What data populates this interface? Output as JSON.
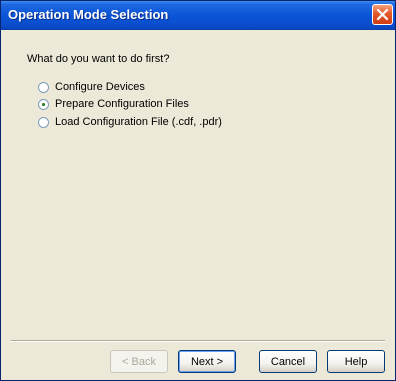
{
  "window": {
    "title": "Operation Mode Selection"
  },
  "dialog": {
    "prompt": "What do you want to do first?",
    "options": [
      {
        "label": "Configure Devices",
        "selected": false
      },
      {
        "label": "Prepare Configuration Files",
        "selected": true
      },
      {
        "label": "Load Configuration File (.cdf, .pdr)",
        "selected": false
      }
    ]
  },
  "buttons": {
    "back": "< Back",
    "next": "Next >",
    "cancel": "Cancel",
    "help": "Help"
  }
}
